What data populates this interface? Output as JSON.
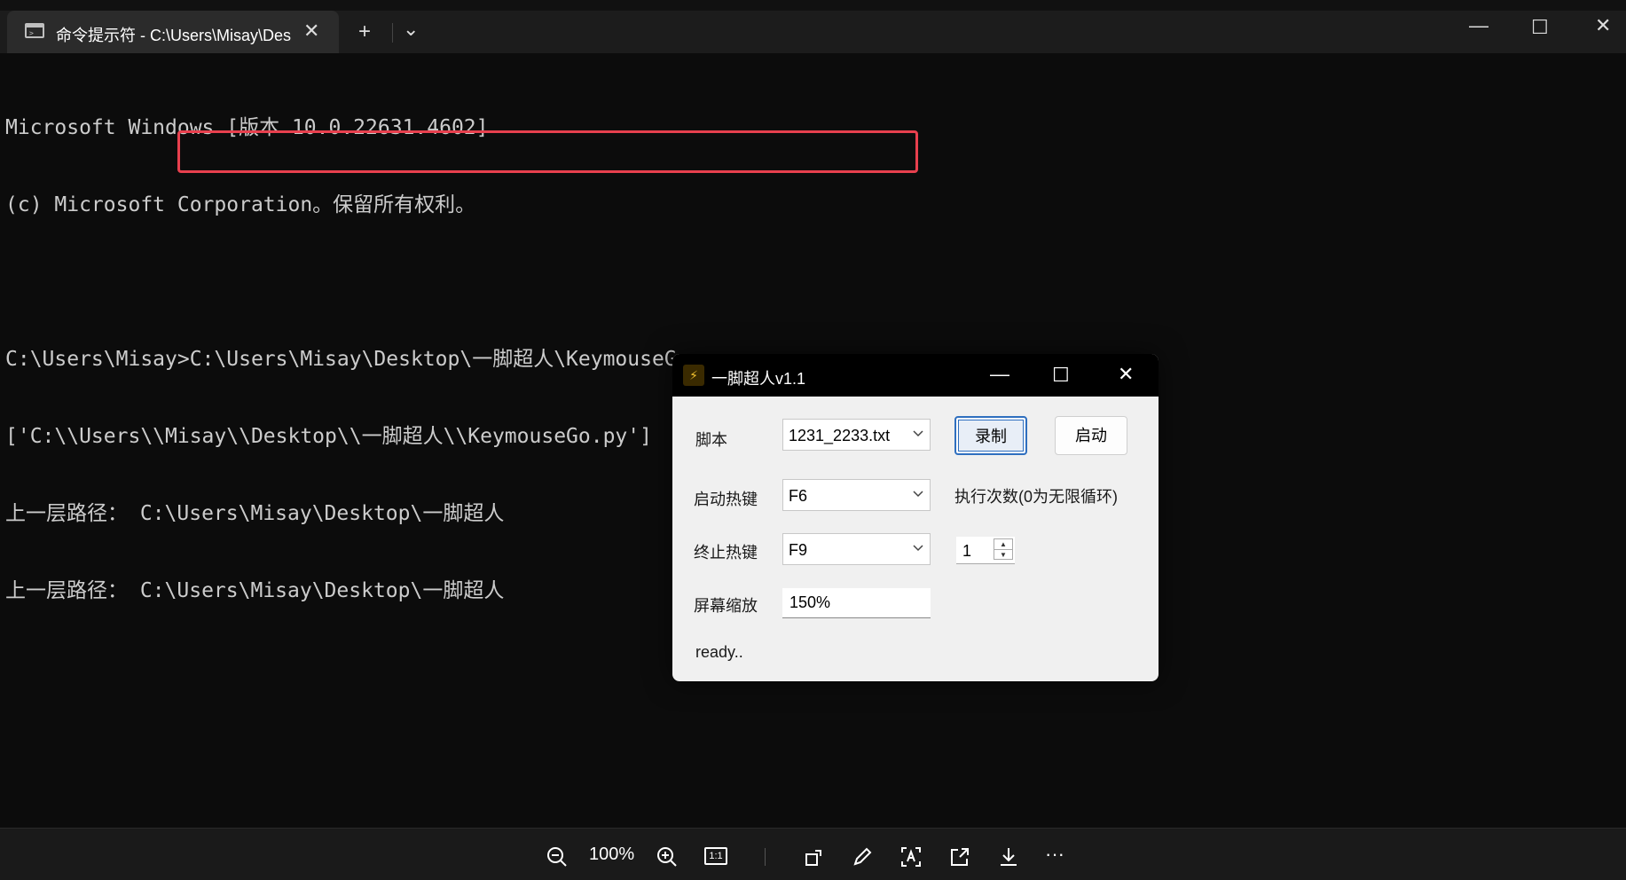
{
  "window": {
    "tab_title": "命令提示符 - C:\\Users\\Misay\\Desktop\\一脚超人\\KeymouseGo.py",
    "tab_close": "✕",
    "new_tab": "+",
    "dropdown": "⌄",
    "minimize": "—",
    "maximize": "☐",
    "close": "✕"
  },
  "console": {
    "lines": [
      "Microsoft Windows [版本 10.0.22631.4602]",
      "(c) Microsoft Corporation。保留所有权利。",
      "",
      "C:\\Users\\Misay>C:\\Users\\Misay\\Desktop\\一脚超人\\KeymouseGo.py",
      "['C:\\\\Users\\\\Misay\\\\Desktop\\\\一脚超人\\\\KeymouseGo.py']",
      "上一层路径： C:\\Users\\Misay\\Desktop\\一脚超人",
      "上一层路径： C:\\Users\\Misay\\Desktop\\一脚超人"
    ]
  },
  "dialog": {
    "title": "一脚超人v1.1",
    "minimize": "—",
    "maximize": "☐",
    "close": "✕",
    "script_label": "脚本",
    "script_value": "1231_2233.txt",
    "record_button": "录制",
    "start_button": "启动",
    "start_hotkey_label": "启动热键",
    "start_hotkey_value": "F6",
    "run_count_label": "执行次数(0为无限循环)",
    "stop_hotkey_label": "终止热键",
    "stop_hotkey_value": "F9",
    "run_count_value": "1",
    "scale_label": "屏幕缩放",
    "scale_value": "150%",
    "status": "ready.."
  },
  "toolbar": {
    "zoom": "100%",
    "actual_size": "1:1",
    "more": "···"
  },
  "colors": {
    "highlight": "#e8404e",
    "focus": "#2f6fbf"
  }
}
